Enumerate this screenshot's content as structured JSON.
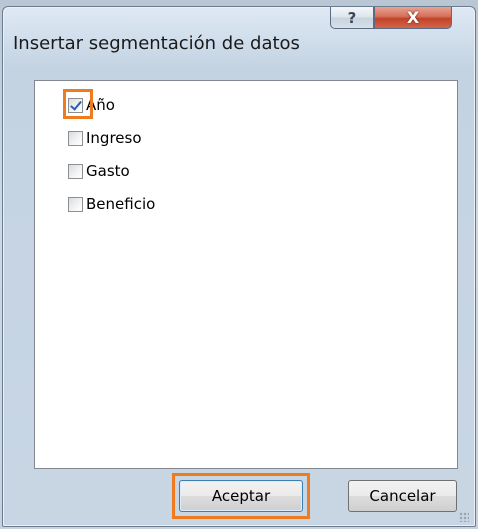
{
  "window": {
    "title": "Insertar segmentación de datos",
    "help_label": "?",
    "close_label": "X"
  },
  "fields": [
    {
      "label": "Año",
      "checked": true
    },
    {
      "label": "Ingreso",
      "checked": false
    },
    {
      "label": "Gasto",
      "checked": false
    },
    {
      "label": "Beneficio",
      "checked": false
    }
  ],
  "buttons": {
    "accept_label": "Aceptar",
    "cancel_label": "Cancelar"
  },
  "colors": {
    "highlight": "#f07a1e",
    "check": "#2c5bb8"
  }
}
